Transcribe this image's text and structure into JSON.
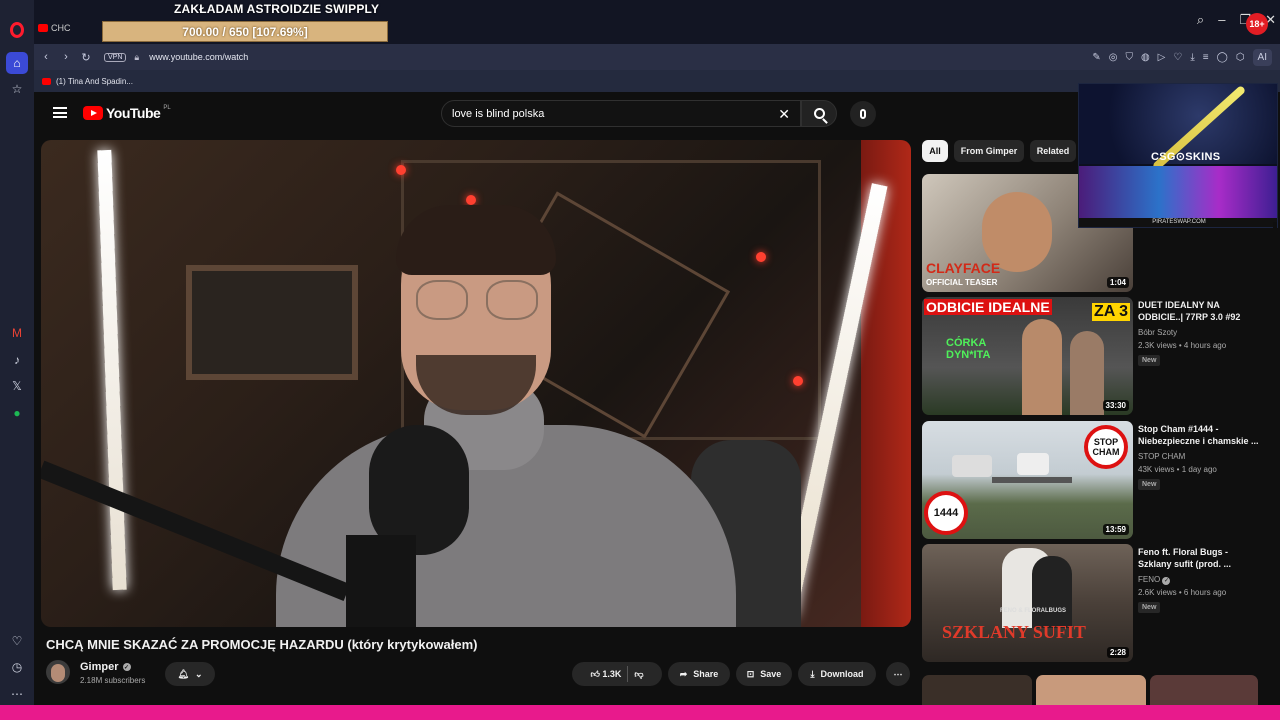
{
  "browser": {
    "tab_label": "CHC",
    "url": "www.youtube.com/watch",
    "vpn_label": "VPN",
    "bookmark_label": "(1) Tina And Spadin...",
    "ai_label": "AI"
  },
  "stream_overlay": {
    "title": "ZAKŁADAM ASTROIDZIE SWIPPLY",
    "goal": "700.00 / 650 [107.69%]",
    "age_badge": "18+"
  },
  "youtube": {
    "logo_text": "YouTube",
    "logo_country": "PL",
    "search_query": "love is blind polska"
  },
  "video": {
    "title": "CHCĄ MNIE SKAZAĆ ZA PROMOCJĘ HAZARDU (który krytykowałem)",
    "channel": "Gimper",
    "subscribers": "2.18M subscribers",
    "likes": "1.3K",
    "share_label": "Share",
    "save_label": "Save",
    "download_label": "Download"
  },
  "chips": [
    "All",
    "From Gimper",
    "Related"
  ],
  "related": [
    {
      "title": "",
      "channel": "",
      "meta": "",
      "duration": "1:04",
      "thumb_text": "CLAYFACE",
      "thumb_sub": "OFFICIAL TEASER",
      "badge": ""
    },
    {
      "title": "DUET IDEALNY NA ODBICIE..| 77RP 3.0 #92",
      "channel": "Bóbr Szoty",
      "meta": "2.3K views • 4 hours ago",
      "duration": "33:30",
      "thumb_text": "ODBICIE IDEALNE",
      "thumb_sub": "ZA 3",
      "thumb_extra": "CÓRKA DYN*ITA",
      "badge": "New"
    },
    {
      "title": "Stop Cham #1444 - Niebezpieczne i chamskie ...",
      "channel": "STOP CHAM",
      "meta": "43K views • 1 day ago",
      "duration": "13:59",
      "thumb_text": "STOP CHAM",
      "thumb_sub": "1444",
      "badge": "New"
    },
    {
      "title": "Feno ft. Floral Bugs - Szklany sufit (prod. ...",
      "channel": "FENO",
      "meta": "2.6K views • 6 hours ago",
      "duration": "2:28",
      "thumb_text": "SZKLANY SUFIT",
      "thumb_sub": "FENO & FLORALBUGS",
      "badge": "New"
    }
  ],
  "ad": {
    "brand": "CSG⊙SKINS",
    "footer": "PIRATESWAP.COM"
  },
  "colors": {
    "yt_red": "#ff0000",
    "opera_red": "#ff1b2d",
    "bottom_bar": "#e81a8c"
  }
}
